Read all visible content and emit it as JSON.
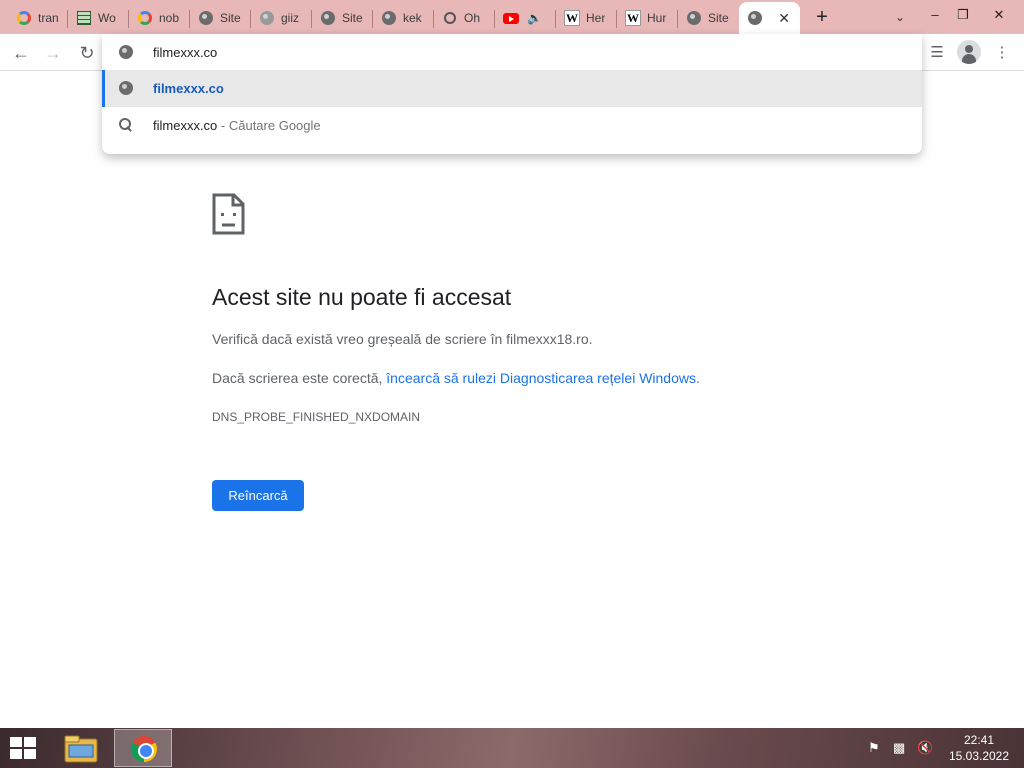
{
  "tabs": [
    {
      "title": "tran",
      "favicon": "google-icon"
    },
    {
      "title": "Wo",
      "favicon": "spreadsheet-icon"
    },
    {
      "title": "nob",
      "favicon": "google-icon"
    },
    {
      "title": "Site",
      "favicon": "globe-icon"
    },
    {
      "title": "giiz",
      "favicon": "globe-icon"
    },
    {
      "title": "Site",
      "favicon": "globe-icon"
    },
    {
      "title": "kek",
      "favicon": "globe-icon"
    },
    {
      "title": "Oh",
      "favicon": "ghost-icon"
    },
    {
      "title": "",
      "favicon": "youtube-icon"
    },
    {
      "title": "Her",
      "favicon": "wikipedia-icon"
    },
    {
      "title": "Hur",
      "favicon": "wikipedia-icon"
    },
    {
      "title": "Site",
      "favicon": "globe-icon"
    },
    {
      "title": "",
      "favicon": "globe-icon",
      "active": true
    }
  ],
  "omnibox": {
    "input_value": "filmexxx.co",
    "suggestions": [
      {
        "text": "filmexxx.co",
        "suffix": "",
        "icon": "globe-icon",
        "selected": true
      },
      {
        "text": "filmexxx.co",
        "suffix": " - Căutare Google",
        "icon": "search-icon",
        "selected": false
      }
    ]
  },
  "error_page": {
    "title": "Acest site nu poate fi accesat",
    "line1": "Verifică dacă există vreo greșeală de scriere în filmexxx18.ro.",
    "line2_prefix": "Dacă scrierea este corectă, ",
    "line2_link": "încearcă să rulezi Diagnosticarea rețelei Windows",
    "line2_suffix": ".",
    "error_code": "DNS_PROBE_FINISHED_NXDOMAIN",
    "reload_button": "Reîncarcă"
  },
  "taskbar": {
    "time": "22:41",
    "date": "15.03.2022"
  },
  "colors": {
    "tab_strip": "#e8b7b7",
    "accent_blue": "#1a73e8",
    "selected_suggestion_bg": "#e8e8e9"
  }
}
